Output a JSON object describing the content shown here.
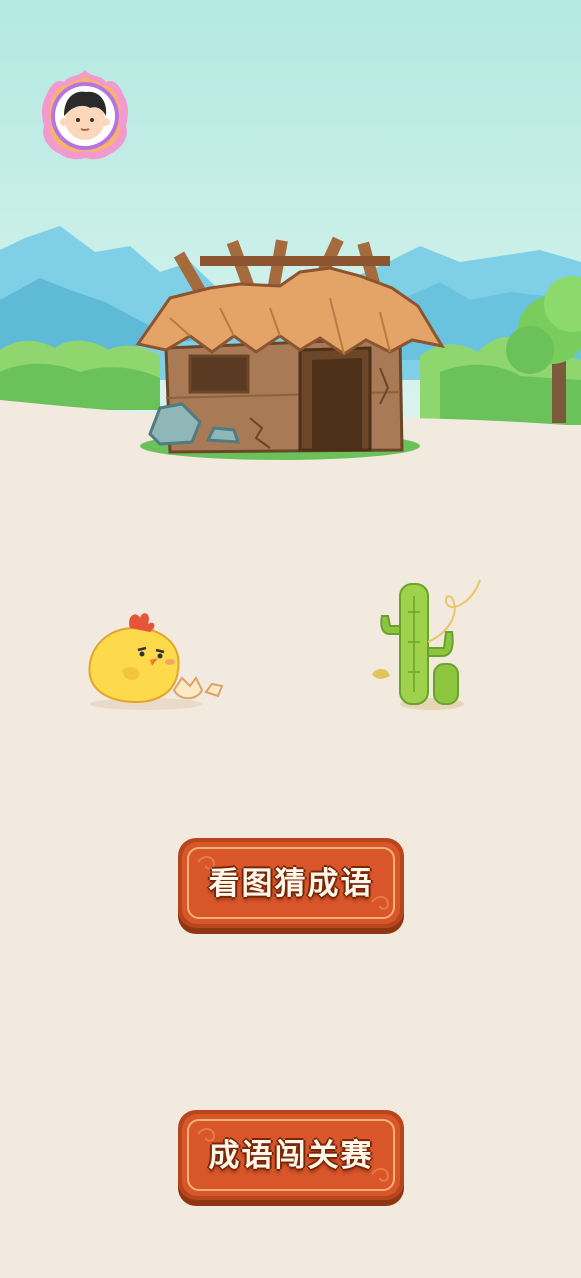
{
  "menu": {
    "guess_idiom_label": "看图猜成语",
    "idiom_challenge_label": "成语闯关赛"
  },
  "icons": {
    "avatar": "player-avatar-icon",
    "hut": "broken-hut-icon",
    "chick": "hatching-chick-icon",
    "cactus": "cactus-icon"
  },
  "colors": {
    "sky_top": "#b4e9e1",
    "ground": "#f2e9df",
    "button_fill": "#d8562a",
    "button_border": "#b7461d",
    "button_inner_line": "#f3b277",
    "button_text": "#fff8ea"
  }
}
